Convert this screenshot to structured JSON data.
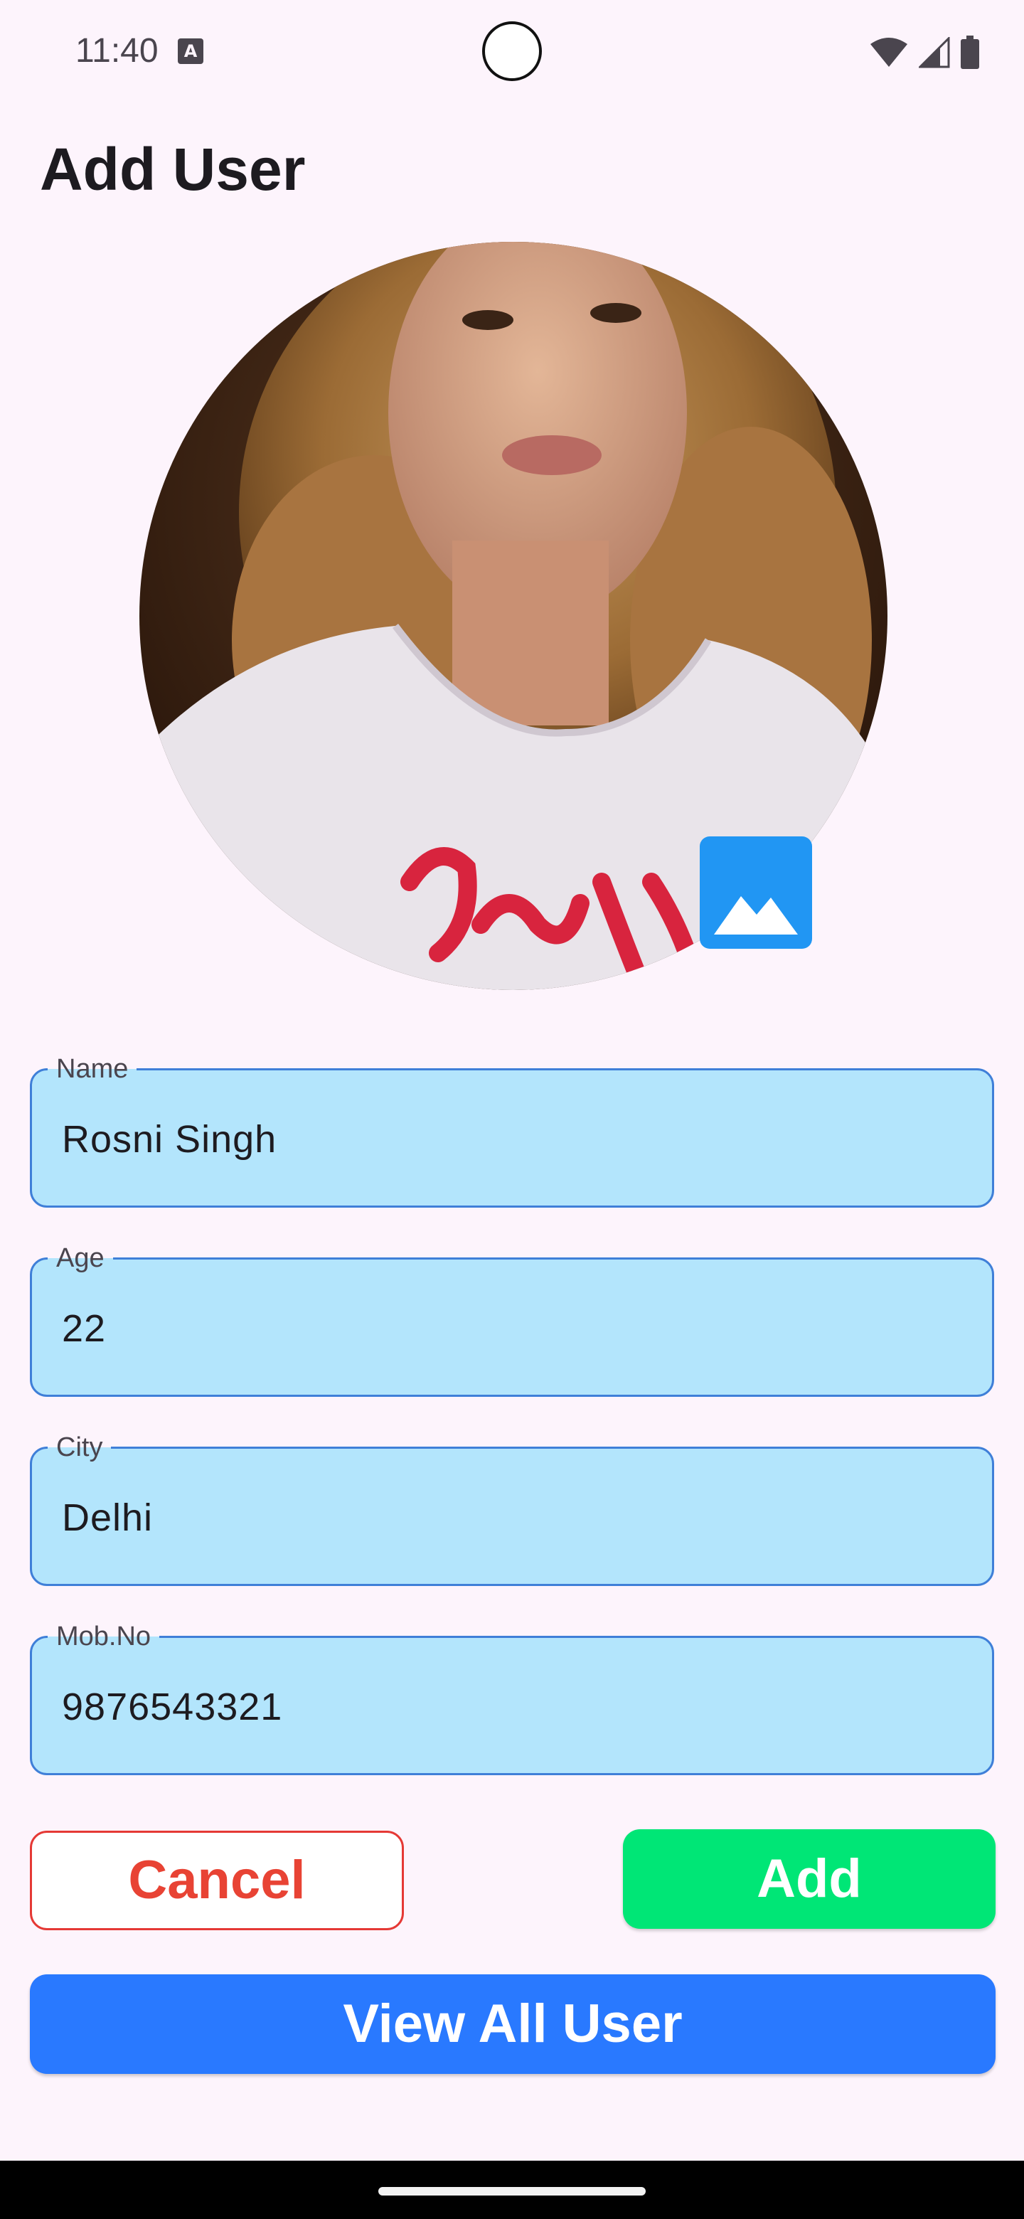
{
  "status_bar": {
    "time": "11:40",
    "notification_icon": "a-icon",
    "icons": [
      "wifi-icon",
      "signal-icon",
      "battery-icon"
    ]
  },
  "page": {
    "title": "Add User"
  },
  "avatar": {
    "description_icon": "profile-photo",
    "picker_icon": "image-icon",
    "picker_color": "#2196f3"
  },
  "form": {
    "name": {
      "label": "Name",
      "value": "Rosni Singh"
    },
    "age": {
      "label": "Age",
      "value": "22"
    },
    "city": {
      "label": "City",
      "value": "Delhi"
    },
    "mobile": {
      "label": "Mob.No",
      "value": "9876543321"
    },
    "field_fill": "#b3e5fc",
    "field_border": "#3f7fd8"
  },
  "actions": {
    "cancel_label": "Cancel",
    "add_label": "Add",
    "view_all_label": "View All User",
    "cancel_color": "#e53935",
    "add_color": "#00e676",
    "view_color": "#2979ff"
  }
}
